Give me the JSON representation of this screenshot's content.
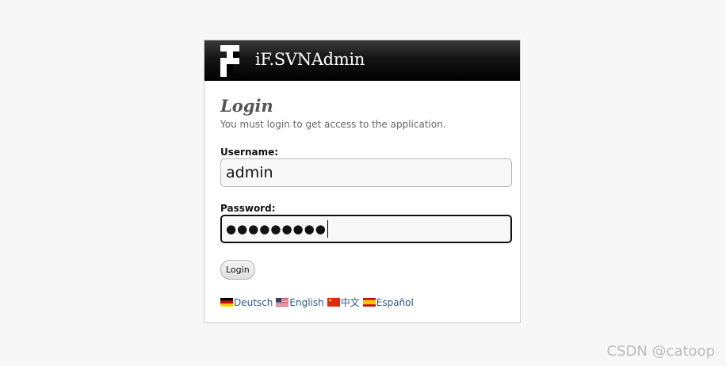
{
  "app": {
    "title": "iF.SVNAdmin"
  },
  "login": {
    "heading": "Login",
    "subtitle": "You must login to get access to the application.",
    "username_label": "Username:",
    "username_value": "admin",
    "password_label": "Password:",
    "password_masked": "●●●●●●●●●",
    "submit_label": "Login"
  },
  "languages": [
    {
      "label": "Deutsch",
      "flag": "de-flag-icon"
    },
    {
      "label": "English",
      "flag": "us-flag-icon"
    },
    {
      "label": "中文",
      "flag": "cn-flag-icon"
    },
    {
      "label": "Español",
      "flag": "es-flag-icon"
    }
  ],
  "watermark": "CSDN @catoop",
  "colors": {
    "link": "#2c5a86",
    "header": "#000000",
    "heading": "#555555"
  }
}
